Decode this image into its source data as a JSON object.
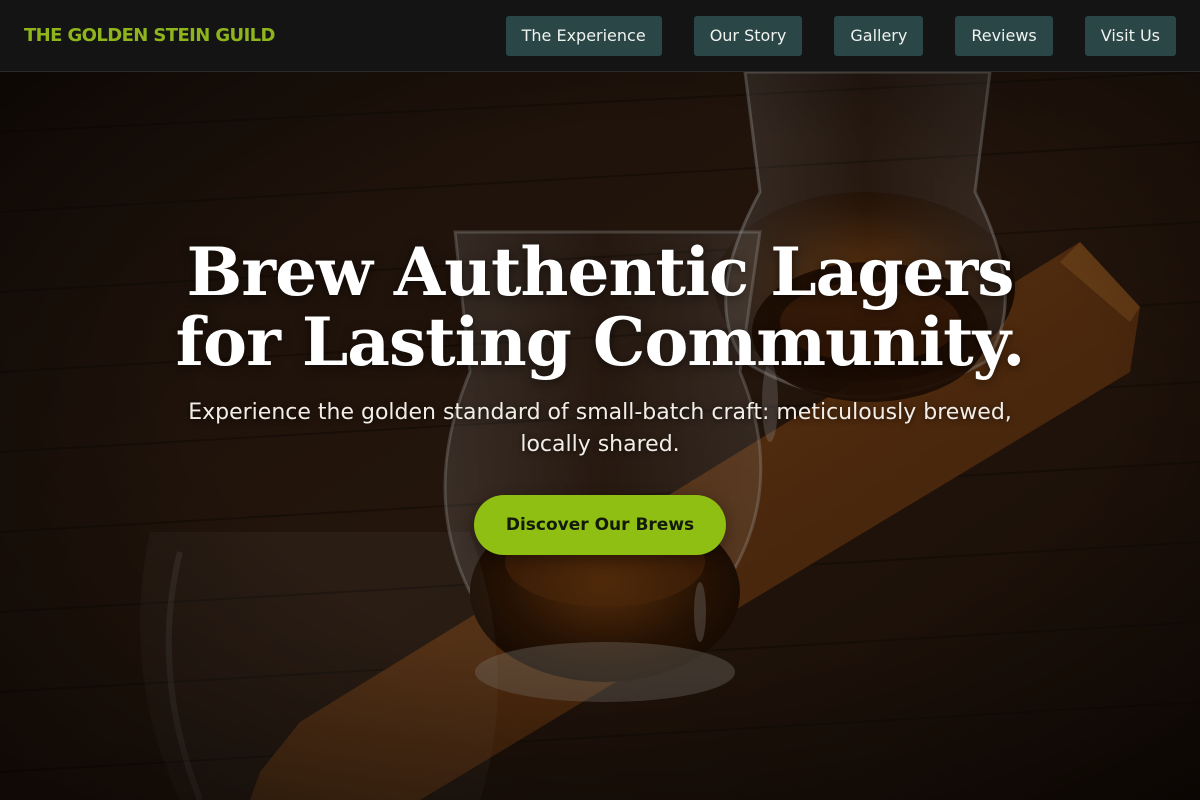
{
  "header": {
    "brand": "THE GOLDEN STEIN GUILD",
    "nav": [
      {
        "label": "The Experience"
      },
      {
        "label": "Our Story"
      },
      {
        "label": "Gallery"
      },
      {
        "label": "Reviews"
      },
      {
        "label": "Visit Us"
      }
    ]
  },
  "hero": {
    "title_line1": "Brew Authentic Lagers",
    "title_line2": "for Lasting Community.",
    "subtitle": "Experience the golden standard of small-batch craft: meticulously brewed, locally shared.",
    "cta_label": "Discover Our Brews"
  },
  "colors": {
    "brand": "#8fb51d",
    "nav_button_bg": "#2b4647",
    "cta_bg": "#8fbf12",
    "header_bg": "#141414"
  }
}
